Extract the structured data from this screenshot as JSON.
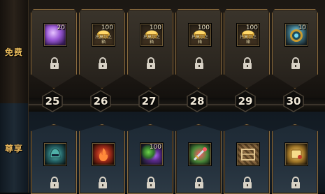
{
  "sections": {
    "free_label": "免费",
    "premium_label": "尊享"
  },
  "levels": [
    "25",
    "26",
    "27",
    "28",
    "29",
    "30"
  ],
  "free_rewards": [
    {
      "icon": "crystal-icon",
      "count": "20",
      "sub": "",
      "locked": true
    },
    {
      "icon": "gold-chest-icon",
      "count": "100",
      "sub": "托莫尔之箱",
      "locked": true
    },
    {
      "icon": "gold-chest-icon",
      "count": "100",
      "sub": "托莫尔之箱",
      "locked": true
    },
    {
      "icon": "gold-chest-icon",
      "count": "100",
      "sub": "托莫尔之箱",
      "locked": true
    },
    {
      "icon": "gold-chest-icon",
      "count": "100",
      "sub": "托莫尔之箱",
      "locked": true
    },
    {
      "icon": "coin-icon",
      "count": "10",
      "sub": "",
      "locked": true
    }
  ],
  "premium_rewards": [
    {
      "icon": "helmet-icon",
      "count": "",
      "locked": true
    },
    {
      "icon": "fire-item-icon",
      "count": "",
      "locked": true
    },
    {
      "icon": "orbs-icon",
      "count": "100",
      "locked": true
    },
    {
      "icon": "sword-icon",
      "count": "",
      "locked": true
    },
    {
      "icon": "crate-icon",
      "count": "",
      "locked": true
    },
    {
      "icon": "scroll-icon",
      "count": "",
      "locked": true
    }
  ],
  "colors": {
    "frame_gold": "#8a6c3f",
    "label_gold": "#e7b95a",
    "free_bg": "#211c16",
    "premium_bg": "#16212b"
  }
}
